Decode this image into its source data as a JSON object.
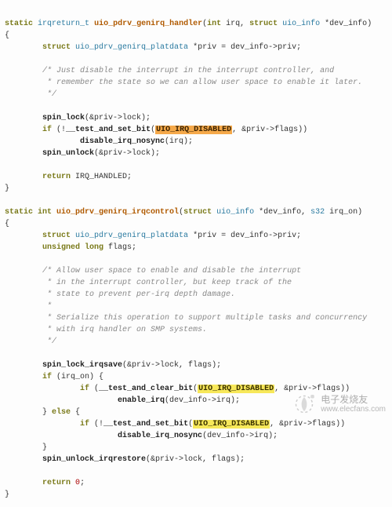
{
  "func1": {
    "sig": {
      "kw_static": "static",
      "ret_type": "irqreturn_t",
      "name": "uio_pdrv_genirq_handler",
      "params_open": "(",
      "p1_type": "int",
      "p1_name": " irq, ",
      "p2_kw": "struct",
      "p2_type": " uio_info ",
      "p2_name": "*dev_info",
      "params_close": ")"
    },
    "brace_open": "{",
    "line_decl": {
      "kw": "struct",
      "type": " uio_pdrv_genirq_platdata ",
      "rest": "*priv = dev_info->priv;"
    },
    "comment1": "/* Just disable the interrupt in the interrupt controller, and",
    "comment2": " * remember the state so we can allow user space to enable it later.",
    "comment3": " */",
    "spinlock": "spin_lock",
    "spinlock_arg": "(&priv->lock);",
    "if_kw": "if",
    "if_open": " (!",
    "if_fn": "__test_and_set_bit",
    "if_paren": "(",
    "if_flag": "UIO_IRQ_DISABLED",
    "if_rest": ", &priv->flags))",
    "disable_fn": "disable_irq_nosync",
    "disable_arg": "(irq);",
    "spinunlock": "spin_unlock",
    "spinunlock_arg": "(&priv->lock);",
    "ret_kw": "return",
    "ret_val": " IRQ_HANDLED;",
    "brace_close": "}"
  },
  "func2": {
    "sig": {
      "kw_static": "static",
      "ret_type": " int ",
      "name": "uio_pdrv_genirq_irqcontrol",
      "params_open": "(",
      "p1_kw": "struct",
      "p1_type": " uio_info ",
      "p1_name": "*dev_info, ",
      "p2_type": "s32",
      "p2_name": " irq_on",
      "params_close": ")"
    },
    "brace_open": "{",
    "line_decl1": {
      "kw": "struct",
      "type": " uio_pdrv_genirq_platdata ",
      "rest": "*priv = dev_info->priv;"
    },
    "line_decl2": {
      "kw": "unsigned long",
      "rest": " flags;"
    },
    "c1": "/* Allow user space to enable and disable the interrupt",
    "c2": " * in the interrupt controller, but keep track of the",
    "c3": " * state to prevent per-irq depth damage.",
    "c4": " *",
    "c5": " * Serialize this operation to support multiple tasks and concurrency",
    "c6": " * with irq handler on SMP systems.",
    "c7": " */",
    "lock_fn": "spin_lock_irqsave",
    "lock_arg": "(&priv->lock, flags);",
    "if_kw": "if",
    "if_cond": " (irq_on) {",
    "inner_if1_kw": "if",
    "inner_if1_open": " (",
    "inner_if1_fn": "__test_and_clear_bit",
    "inner_if1_paren": "(",
    "inner_if1_flag": "UIO_IRQ_DISABLED",
    "inner_if1_rest": ", &priv->flags))",
    "enable_fn": "enable_irq",
    "enable_arg": "(dev_info->irq);",
    "else_line": "} ",
    "else_kw": "else",
    "else_brace": " {",
    "inner_if2_kw": "if",
    "inner_if2_open": " (!",
    "inner_if2_fn": "__test_and_set_bit",
    "inner_if2_paren": "(",
    "inner_if2_flag": "UIO_IRQ_DISABLED",
    "inner_if2_rest": ", &priv->flags))",
    "disable_fn": "disable_irq_nosync",
    "disable_arg": "(dev_info->irq);",
    "close_else": "}",
    "unlock_fn": "spin_unlock_irqrestore",
    "unlock_arg": "(&priv->lock, flags);",
    "ret_kw": "return",
    "ret_val": " ",
    "ret_num": "0",
    "ret_semi": ";",
    "brace_close": "}"
  },
  "watermark": {
    "cn": "电子发烧友",
    "url": "www.elecfans.com"
  }
}
